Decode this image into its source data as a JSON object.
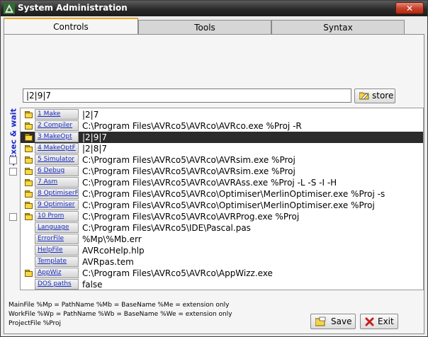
{
  "window": {
    "title": "System Administration",
    "close_glyph": "✕"
  },
  "tabs": [
    {
      "label": "Controls",
      "active": true
    },
    {
      "label": "Tools",
      "active": false
    },
    {
      "label": "Syntax",
      "active": false
    }
  ],
  "exec_label": "<Exec & wait",
  "command_input": {
    "value": "|2|9|7"
  },
  "store_button": {
    "label": "store",
    "icon": "folder-edit-icon"
  },
  "rows": [
    {
      "label": "1 Make",
      "value": "|2|7",
      "checkbox": false,
      "folder": true,
      "selected": false
    },
    {
      "label": "2 Compiler",
      "value": "C:\\Program Files\\AVRco5\\AVRco\\AVRco.exe %Proj -R",
      "checkbox": false,
      "folder": true,
      "selected": false
    },
    {
      "label": "3 MakeOpt",
      "value": "|2|9|7",
      "checkbox": false,
      "folder": true,
      "selected": true
    },
    {
      "label": "4 MakeOptF",
      "value": "|2|8|7",
      "checkbox": false,
      "folder": true,
      "selected": false
    },
    {
      "label": "5 Simulator",
      "value": "C:\\Program Files\\AVRco5\\AVRco\\AVRsim.exe %Proj",
      "checkbox": true,
      "folder": true,
      "selected": false
    },
    {
      "label": "6 Debug",
      "value": "C:\\Program Files\\AVRco5\\AVRco\\AVRsim.exe %Proj",
      "checkbox": true,
      "folder": true,
      "selected": false
    },
    {
      "label": "7 Asm",
      "value": "C:\\Program Files\\AVRco5\\AVRco\\AVRAss.exe %Proj -L -S -I -H",
      "checkbox": false,
      "folder": true,
      "selected": false
    },
    {
      "label": "8 OptimiserF",
      "value": "C:\\Program Files\\AVRco5\\AVRco\\Optimiser\\MerlinOptimiser.exe %Proj -s",
      "checkbox": false,
      "folder": true,
      "selected": false
    },
    {
      "label": "9 Optimiser",
      "value": "C:\\Program Files\\AVRco5\\AVRco\\Optimiser\\MerlinOptimiser.exe %Proj",
      "checkbox": false,
      "folder": true,
      "selected": false
    },
    {
      "label": "10 Prom",
      "value": "C:\\Program Files\\AVRco5\\AVRco\\AVRProg.exe %Proj",
      "checkbox": true,
      "folder": true,
      "selected": false
    },
    {
      "label": "Language",
      "value": "C:\\Program Files\\AVRco5\\IDE\\Pascal.pas",
      "checkbox": false,
      "folder": false,
      "selected": false
    },
    {
      "label": "ErrorFile",
      "value": "%Mp\\%Mb.err",
      "checkbox": false,
      "folder": false,
      "selected": false
    },
    {
      "label": "HelpFile",
      "value": "AVRcoHelp.hlp",
      "checkbox": false,
      "folder": false,
      "selected": false
    },
    {
      "label": "Template",
      "value": "AVRpas.tem",
      "checkbox": false,
      "folder": false,
      "selected": false
    },
    {
      "label": "AppWiz",
      "value": "C:\\Program Files\\AVRco5\\AVRco\\AppWizz.exe",
      "checkbox": false,
      "folder": true,
      "selected": false
    },
    {
      "label": "DOS paths",
      "value": "false",
      "checkbox": false,
      "folder": false,
      "selected": false
    }
  ],
  "notes": [
    "MainFile %Mp = PathName  %Mb = BaseName  %Me = extension only",
    "WorkFile %Wp = PathName  %Wb = BaseName  %We = extension only",
    "ProjectFile %Proj"
  ],
  "save_button": {
    "label": "Save",
    "icon": "folder-save-icon"
  },
  "exit_button": {
    "label": "Exit",
    "icon": "red-x-icon"
  },
  "colors": {
    "accent": "#f0a818",
    "selection": "#2b2b2b",
    "link": "#1a2ec0",
    "exec_label": "#1a28c8"
  }
}
